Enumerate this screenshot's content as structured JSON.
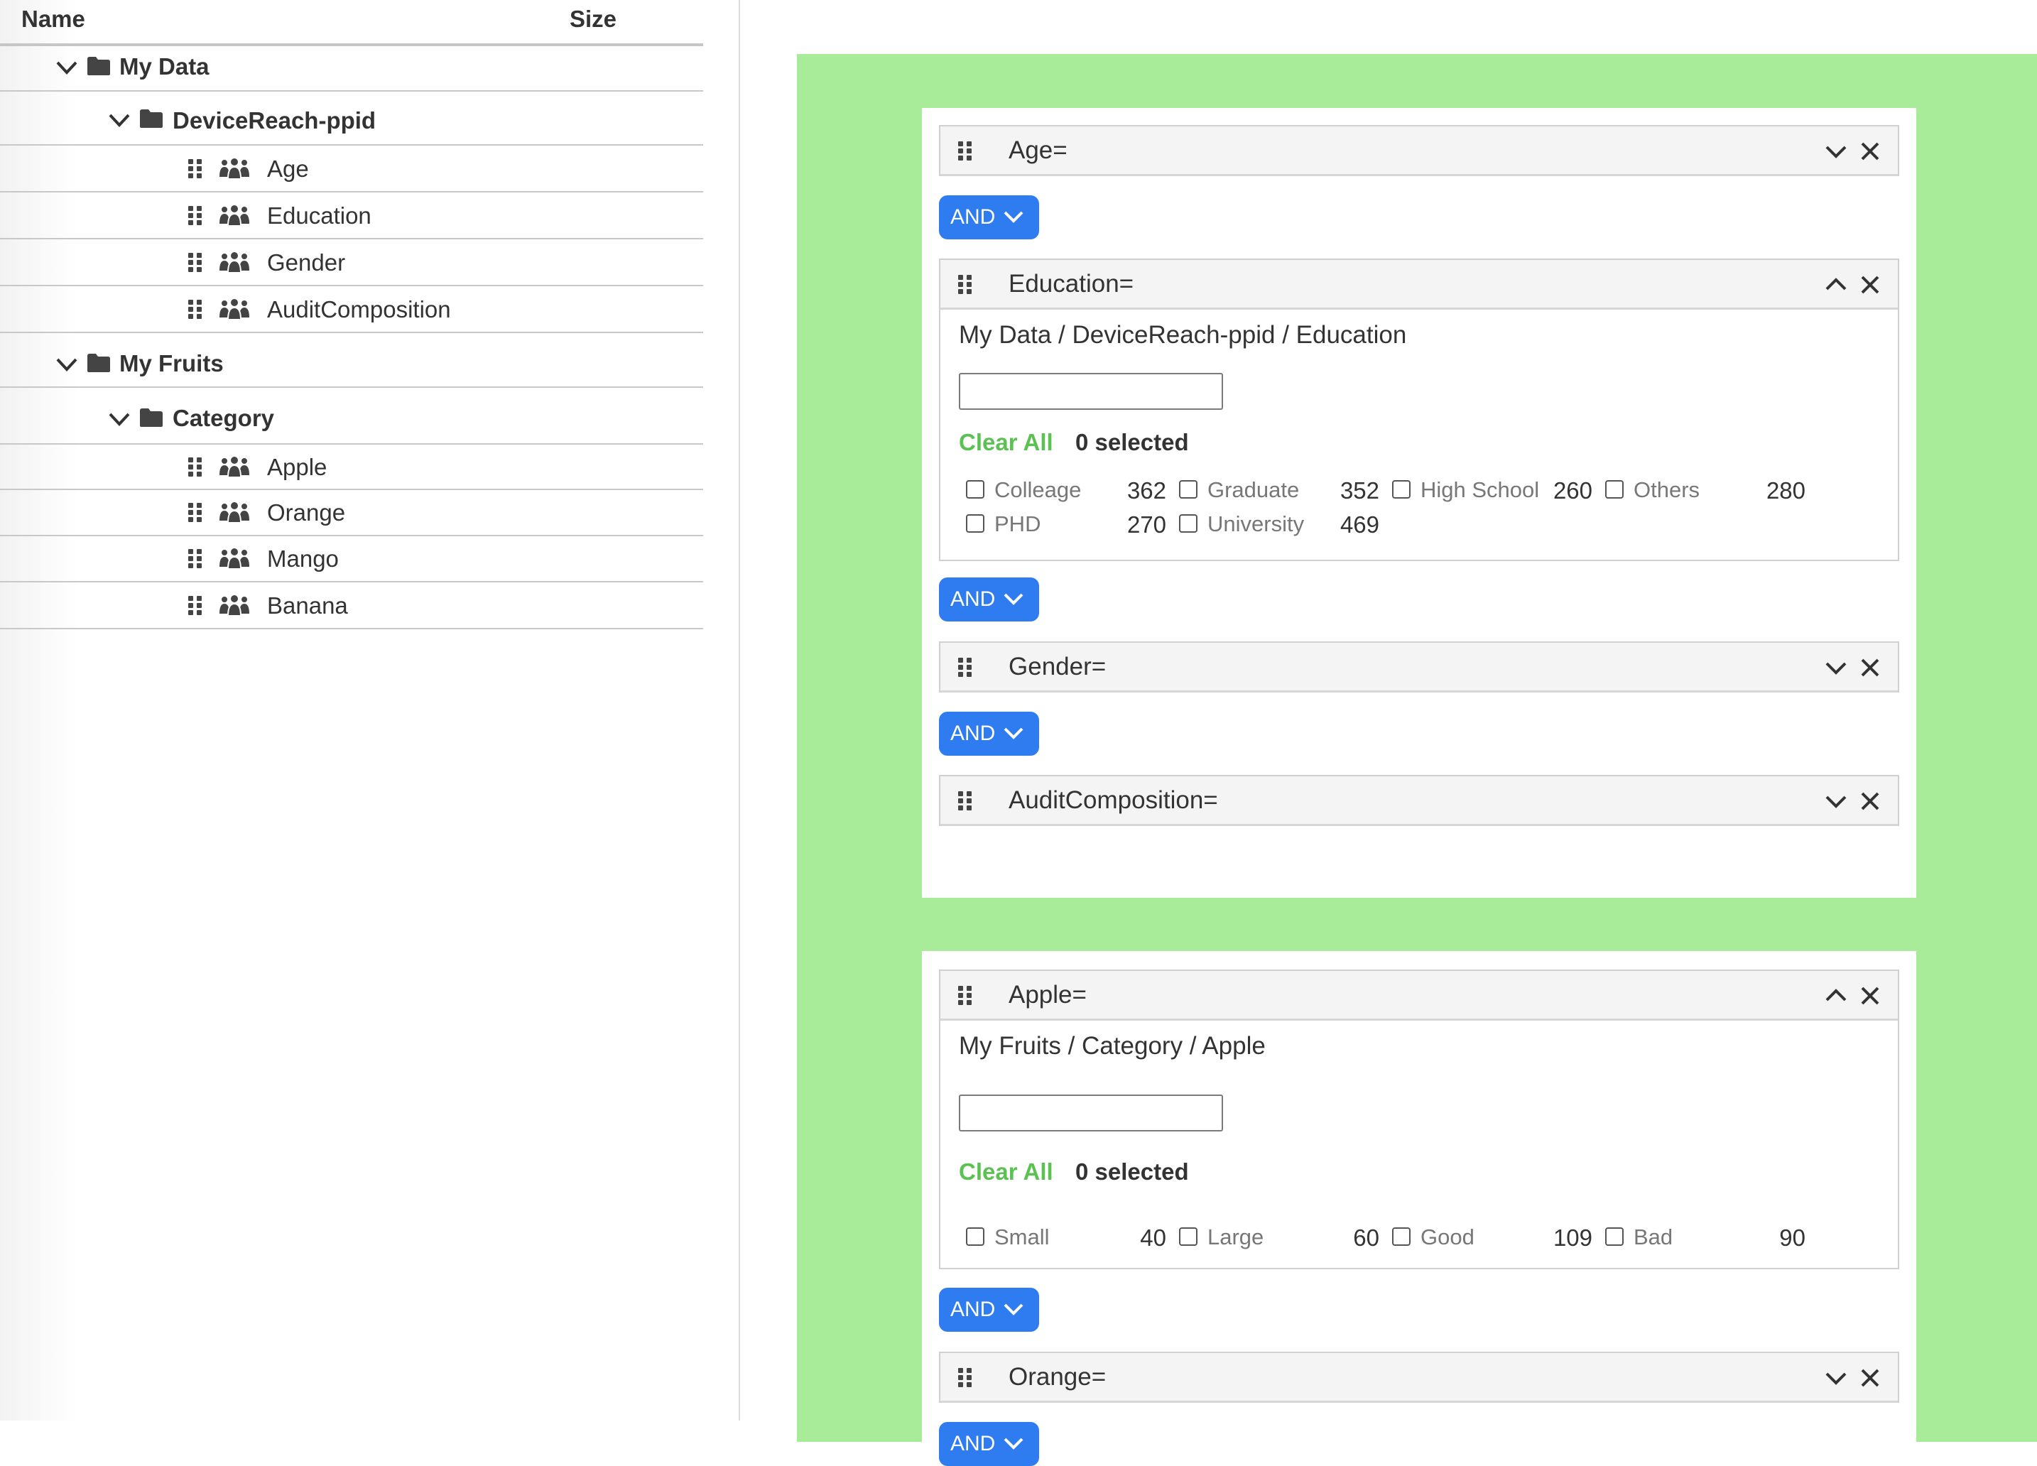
{
  "tree": {
    "header": {
      "name": "Name",
      "size": "Size"
    },
    "folders": [
      {
        "label": "My Data",
        "subfolder": {
          "label": "DeviceReach-ppid",
          "items": [
            "Age",
            "Education",
            "Gender",
            "AuditComposition"
          ]
        }
      },
      {
        "label": "My Fruits",
        "subfolder": {
          "label": "Category",
          "items": [
            "Apple",
            "Orange",
            "Mango",
            "Banana"
          ]
        }
      }
    ]
  },
  "query": {
    "and_label": "AND",
    "group1": {
      "filters": {
        "age": {
          "title": "Age="
        },
        "education": {
          "title": "Education=",
          "path": "My Data / DeviceReach-ppid / Education",
          "search_value": "",
          "clear_all": "Clear All",
          "selected": "0 selected",
          "options": [
            {
              "label": "Colleage",
              "count": "362"
            },
            {
              "label": "Graduate",
              "count": "352"
            },
            {
              "label": "High School",
              "count": "260"
            },
            {
              "label": "Others",
              "count": "280"
            },
            {
              "label": "PHD",
              "count": "270"
            },
            {
              "label": "University",
              "count": "469"
            }
          ]
        },
        "gender": {
          "title": "Gender="
        },
        "audit": {
          "title": "AuditComposition="
        }
      }
    },
    "group2": {
      "filters": {
        "apple": {
          "title": "Apple=",
          "path": "My Fruits / Category / Apple",
          "search_value": "",
          "clear_all": "Clear All",
          "selected": "0 selected",
          "options": [
            {
              "label": "Small",
              "count": "40"
            },
            {
              "label": "Large",
              "count": "60"
            },
            {
              "label": "Good",
              "count": "109"
            },
            {
              "label": "Bad",
              "count": "90"
            }
          ]
        },
        "orange": {
          "title": "Orange="
        }
      }
    }
  },
  "colors": {
    "query_background": "#a8eb98",
    "and_button": "#2f7cf0",
    "clear_all": "#5cc153"
  }
}
